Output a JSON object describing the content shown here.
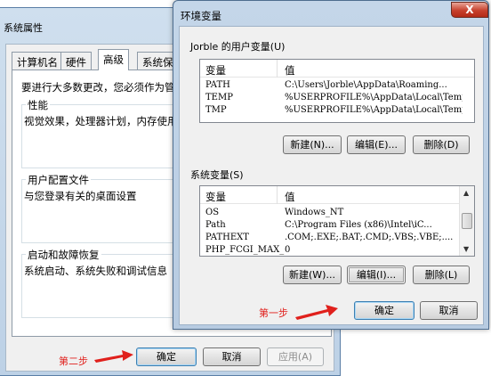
{
  "system_properties": {
    "title": "系统属性",
    "tabs": [
      "计算机名",
      "硬件",
      "高级",
      "系统保"
    ],
    "active_tab_index": 2,
    "intro": "要进行大多数更改，您必须作为管",
    "groups": [
      {
        "caption": "性能",
        "description": "视觉效果，处理器计划，内存使用"
      },
      {
        "caption": "用户配置文件",
        "description": "与您登录有关的桌面设置"
      },
      {
        "caption": "启动和故障恢复",
        "description": "系统启动、系统失败和调试信息"
      }
    ],
    "buttons": {
      "ok": "确定",
      "cancel": "取消",
      "apply": "应用(A)"
    }
  },
  "env_vars": {
    "title": "环境变量",
    "close_label": "X",
    "user_section": {
      "label": "Jorble 的用户变量(U)",
      "columns": {
        "name": "变量",
        "value": "值"
      },
      "rows": [
        {
          "name": "PATH",
          "value": "C:\\Users\\Jorble\\AppData\\Roaming..."
        },
        {
          "name": "TEMP",
          "value": "%USERPROFILE%\\AppData\\Local\\Temp"
        },
        {
          "name": "TMP",
          "value": "%USERPROFILE%\\AppData\\Local\\Temp"
        }
      ],
      "buttons": {
        "new": "新建(N)...",
        "edit": "编辑(E)...",
        "delete": "删除(D)"
      }
    },
    "system_section": {
      "label": "系统变量(S)",
      "columns": {
        "name": "变量",
        "value": "值"
      },
      "rows": [
        {
          "name": "OS",
          "value": "Windows_NT"
        },
        {
          "name": "Path",
          "value": "C:\\Program Files (x86)\\Intel\\iC..."
        },
        {
          "name": "PATHEXT",
          "value": ".COM;.EXE;.BAT;.CMD;.VBS;.VBE;...."
        },
        {
          "name": "PHP_FCGI_MAX_",
          "value": "0"
        }
      ],
      "buttons": {
        "new": "新建(W)...",
        "edit": "编辑(I)...",
        "delete": "删除(L)"
      }
    },
    "footer_buttons": {
      "ok": "确定",
      "cancel": "取消"
    }
  },
  "annotations": {
    "step1": "第一步",
    "step2": "第二步",
    "color": "#e0201c"
  }
}
